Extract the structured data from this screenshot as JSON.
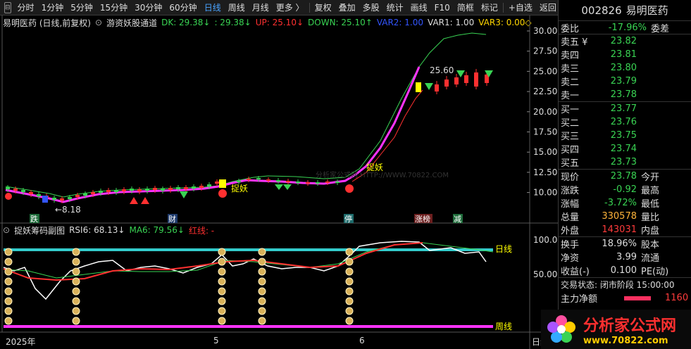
{
  "toolbar": {
    "items": [
      "分时",
      "1分钟",
      "5分钟",
      "15分钟",
      "30分钟",
      "60分钟",
      "日线",
      "周线",
      "月线",
      "更多 〉",
      "复权",
      "叠加",
      "多股",
      "统计",
      "画线",
      "F10",
      "简框",
      "标记",
      "+自选",
      "返回"
    ],
    "active": "日线"
  },
  "main_header": {
    "stock": "易明医药 (日线,前复权)",
    "indicator": "游资妖股通道",
    "dk": "DK: 29.38↓",
    "dk2": ": 29.38↓",
    "up": "UP: 25.10↓",
    "down": "DOWN: 25.10↑",
    "var2": "VAR2: 1.00",
    "var1": "VAR1: 1.00",
    "var3": "VAR3: 0.00◇"
  },
  "sub_header": {
    "indicator": "捉妖筹码副图",
    "rsi6": "RSI6: 68.13↓",
    "ma6": "MA6: 79.56↓",
    "redline": "红线: -"
  },
  "price_axis": [
    "30.00",
    "27.50",
    "25.00",
    "22.50",
    "20.00",
    "17.50",
    "15.00",
    "12.50",
    "10.00"
  ],
  "sub_axis": [
    "100.0",
    "50.00"
  ],
  "time_axis": [
    "2025年",
    "5",
    "6",
    "日线"
  ],
  "chart_labels": {
    "low": "←8.18",
    "high": "25.60",
    "zhuoyao1": "捉妖",
    "zhuoyao2": "捉妖",
    "rixian": "日线",
    "zhouxian": "周线",
    "tags": [
      "跌",
      "财",
      "停",
      "涨榜",
      "减"
    ],
    "watermark": "分析家公式网 HTTP://WWW.70822.COM"
  },
  "right_panel": {
    "code": "002826",
    "name": "易明医药",
    "weibi_label": "委比",
    "weibi_value": "-17.96%",
    "weicha_label": "委差",
    "asks": [
      {
        "label": "卖五 ¥",
        "price": "23.82"
      },
      {
        "label": "卖四",
        "price": "23.81"
      },
      {
        "label": "卖三",
        "price": "23.80"
      },
      {
        "label": "卖二",
        "price": "23.79"
      },
      {
        "label": "卖一",
        "price": "23.78"
      }
    ],
    "bids": [
      {
        "label": "买一",
        "price": "23.77"
      },
      {
        "label": "买二",
        "price": "23.76"
      },
      {
        "label": "买三",
        "price": "23.75"
      },
      {
        "label": "买四",
        "price": "23.74"
      },
      {
        "label": "买五",
        "price": "23.73"
      }
    ],
    "stats": [
      {
        "l1": "现价",
        "v1": "23.78",
        "c1": "green",
        "l2": "今开"
      },
      {
        "l1": "涨跌",
        "v1": "-0.92",
        "c1": "green",
        "l2": "最高"
      },
      {
        "l1": "涨幅",
        "v1": "-3.72%",
        "c1": "green",
        "l2": "最低"
      },
      {
        "l1": "总量",
        "v1": "330578",
        "c1": "orange",
        "l2": "量比"
      },
      {
        "l1": "外盘",
        "v1": "143031",
        "c1": "red",
        "l2": "内盘"
      }
    ],
    "stats2": [
      {
        "l1": "换手",
        "v1": "18.96%",
        "l2": "股本"
      },
      {
        "l1": "净资",
        "v1": "3.99",
        "l2": "流通"
      },
      {
        "l1": "收益(-)",
        "v1": "0.100",
        "l2": "PE(动)"
      }
    ],
    "trade_status": "交易状态: 闭市阶段 15:00:00",
    "main_net_label": "主力净额",
    "main_net_value": "1160"
  },
  "logo": {
    "name": "分析家公式网",
    "url": "www.70822.com"
  },
  "colors": {
    "magenta": "#ff33ff",
    "cyan": "#33cccc",
    "green": "#39d353",
    "red": "#ff3030"
  }
}
